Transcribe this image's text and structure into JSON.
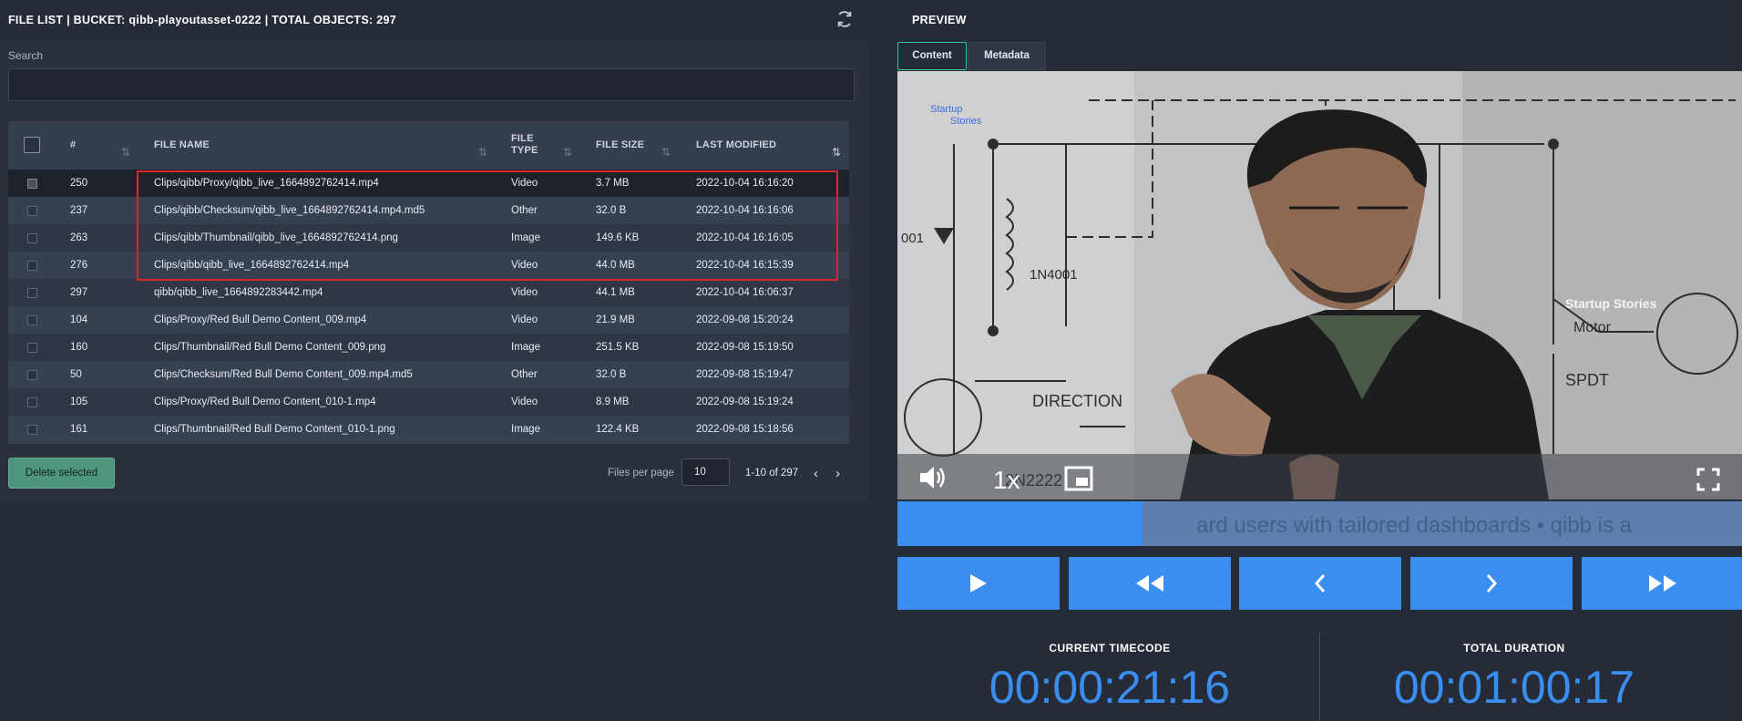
{
  "file_list": {
    "title": "FILE LIST | BUCKET: qibb-playoutasset-0222 | TOTAL OBJECTS: 297",
    "search": {
      "label": "Search",
      "value": "",
      "placeholder": ""
    },
    "columns": {
      "number": "#",
      "file_name": "FILE NAME",
      "file_type_1": "FILE",
      "file_type_2": "TYPE",
      "file_size": "FILE SIZE",
      "last_modified": "LAST MODIFIED"
    },
    "rows": [
      {
        "number": "250",
        "file_name": "Clips/qibb/Proxy/qibb_live_1664892762414.mp4",
        "file_type": "Video",
        "file_size": "3.7 MB",
        "last_modified": "2022-10-04 16:16:20"
      },
      {
        "number": "237",
        "file_name": "Clips/qibb/Checksum/qibb_live_1664892762414.mp4.md5",
        "file_type": "Other",
        "file_size": "32.0 B",
        "last_modified": "2022-10-04 16:16:06"
      },
      {
        "number": "263",
        "file_name": "Clips/qibb/Thumbnail/qibb_live_1664892762414.png",
        "file_type": "Image",
        "file_size": "149.6 KB",
        "last_modified": "2022-10-04 16:16:05"
      },
      {
        "number": "276",
        "file_name": "Clips/qibb/qibb_live_1664892762414.mp4",
        "file_type": "Video",
        "file_size": "44.0 MB",
        "last_modified": "2022-10-04 16:15:39"
      },
      {
        "number": "297",
        "file_name": "qibb/qibb_live_1664892283442.mp4",
        "file_type": "Video",
        "file_size": "44.1 MB",
        "last_modified": "2022-10-04 16:06:37"
      },
      {
        "number": "104",
        "file_name": "Clips/Proxy/Red Bull Demo Content_009.mp4",
        "file_type": "Video",
        "file_size": "21.9 MB",
        "last_modified": "2022-09-08 15:20:24"
      },
      {
        "number": "160",
        "file_name": "Clips/Thumbnail/Red Bull Demo Content_009.png",
        "file_type": "Image",
        "file_size": "251.5 KB",
        "last_modified": "2022-09-08 15:19:50"
      },
      {
        "number": "50",
        "file_name": "Clips/Checksum/Red Bull Demo Content_009.mp4.md5",
        "file_type": "Other",
        "file_size": "32.0 B",
        "last_modified": "2022-09-08 15:19:47"
      },
      {
        "number": "105",
        "file_name": "Clips/Proxy/Red Bull Demo Content_010-1.mp4",
        "file_type": "Video",
        "file_size": "8.9 MB",
        "last_modified": "2022-09-08 15:19:24"
      },
      {
        "number": "161",
        "file_name": "Clips/Thumbnail/Red Bull Demo Content_010-1.png",
        "file_type": "Image",
        "file_size": "122.4 KB",
        "last_modified": "2022-09-08 15:18:56"
      }
    ],
    "selected_row_index": 0,
    "delete_label": "Delete selected",
    "files_per_page_label": "Files per page",
    "files_per_page_value": "10",
    "range_label": "1-10 of 297",
    "prev_icon": "‹",
    "next_icon": "›"
  },
  "preview": {
    "title": "PREVIEW",
    "tabs": [
      "Content",
      "Metadata"
    ],
    "active_tab": "Content",
    "video": {
      "speed_label": "1x",
      "overlay_texts": [
        "Startup Stories",
        "Motor",
        "SPDT",
        "DIRECTION",
        "1N4001",
        "2N2222"
      ]
    },
    "progress_fraction": 0.29,
    "ticker_text": "ard users with tailored dashboards  •  qibb is a",
    "transport_buttons": [
      "play",
      "rewind",
      "previous-frame",
      "next-frame",
      "fast-forward"
    ],
    "current_timecode_label": "CURRENT TIMECODE",
    "current_timecode": "00:00:21:16",
    "total_duration_label": "TOTAL DURATION",
    "total_duration": "00:01:00:17"
  },
  "colors": {
    "accent_blue": "#3a8ef0",
    "delete_green": "#4e9580",
    "active_tab_border": "#3fbf9f",
    "highlight_red": "#d9262c"
  }
}
